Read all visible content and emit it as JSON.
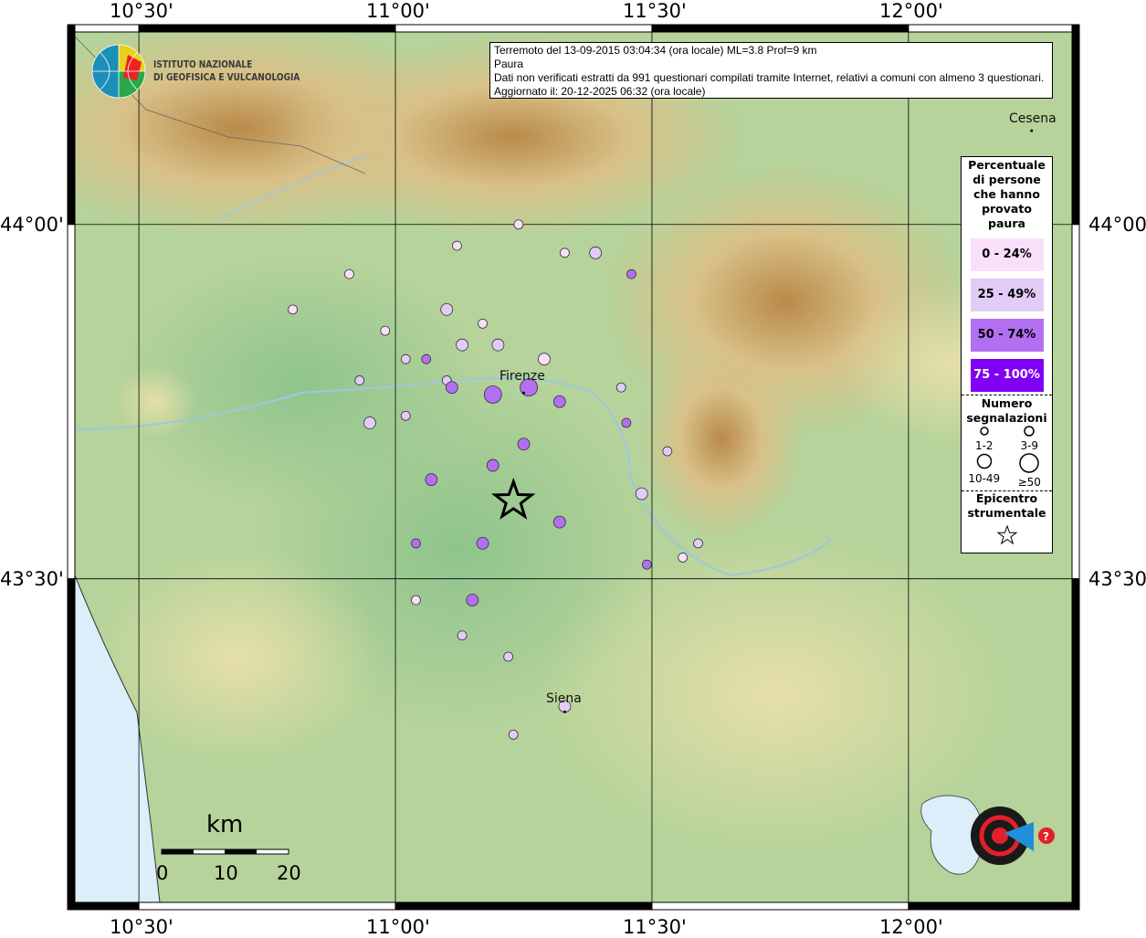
{
  "info_box": {
    "line1": "Terremoto del 13-09-2015 03:04:34 (ora locale) ML=3.8 Prof=9 km",
    "line2": "Paura",
    "line3": "Dati non verificati estratti da 991 questionari compilati tramite Internet, relativi a comuni con almeno 3 questionari.",
    "line4": "Aggiornato il: 20-12-2025 06:32 (ora locale)"
  },
  "axes": {
    "lon_ticks": [
      "10°30'",
      "11°00'",
      "11°30'",
      "12°00'"
    ],
    "lon_values": [
      10.5,
      11.0,
      11.5,
      12.0
    ],
    "lat_ticks": [
      "44°00'",
      "43°30'"
    ],
    "lat_values": [
      44.0,
      43.5
    ],
    "lon_range": [
      10.361,
      12.333
    ],
    "lat_range": [
      43.033,
      44.282
    ]
  },
  "logos": {
    "ingv": "ISTITUTO NAZIONALE DI GEOFISICA E VULCANOLOGIA",
    "ingv_line1": "ISTITUTO NAZIONALE",
    "ingv_line2": "DI GEOFISICA E VULCANOLOGIA",
    "hsit": "www.haisentitoilterremoto.it"
  },
  "cities": [
    {
      "name": "Firenze",
      "lon": 11.25,
      "lat": 43.77
    },
    {
      "name": "Siena",
      "lon": 11.33,
      "lat": 43.32
    },
    {
      "name": "Cesena",
      "lon": 12.24,
      "lat": 44.14
    }
  ],
  "legend": {
    "title": "Percentuale di persone che hanno provato paura",
    "classes": [
      {
        "label": "0 - 24%",
        "color": "#f9dffa"
      },
      {
        "label": "25 - 49%",
        "color": "#e3cbf7"
      },
      {
        "label": "50 - 74%",
        "color": "#b36ff2"
      },
      {
        "label": "75 - 100%",
        "color": "#8000f3"
      }
    ],
    "count_title": "Numero segnalazioni",
    "count_classes": [
      "1-2",
      "3-9",
      "10-49",
      "≥50"
    ],
    "epicenter_title": "Epicentro strumentale"
  },
  "epicenter": {
    "lon": 11.23,
    "lat": 43.61
  },
  "scale_bar": {
    "unit": "km",
    "ticks": [
      "0",
      "10",
      "20"
    ]
  },
  "points": [
    {
      "lon": 11.24,
      "lat": 44.0,
      "c": 0,
      "n": 0
    },
    {
      "lon": 11.12,
      "lat": 43.97,
      "c": 0,
      "n": 0
    },
    {
      "lon": 11.33,
      "lat": 43.96,
      "c": 0,
      "n": 0
    },
    {
      "lon": 11.39,
      "lat": 43.96,
      "c": 1,
      "n": 1
    },
    {
      "lon": 11.46,
      "lat": 43.93,
      "c": 2,
      "n": 0
    },
    {
      "lon": 10.91,
      "lat": 43.93,
      "c": 0,
      "n": 0
    },
    {
      "lon": 10.8,
      "lat": 43.88,
      "c": 0,
      "n": 0
    },
    {
      "lon": 11.1,
      "lat": 43.88,
      "c": 1,
      "n": 1
    },
    {
      "lon": 11.17,
      "lat": 43.86,
      "c": 0,
      "n": 0
    },
    {
      "lon": 10.98,
      "lat": 43.85,
      "c": 0,
      "n": 0
    },
    {
      "lon": 11.2,
      "lat": 43.83,
      "c": 1,
      "n": 1
    },
    {
      "lon": 11.13,
      "lat": 43.83,
      "c": 1,
      "n": 1
    },
    {
      "lon": 11.02,
      "lat": 43.81,
      "c": 1,
      "n": 0
    },
    {
      "lon": 11.06,
      "lat": 43.81,
      "c": 2,
      "n": 0
    },
    {
      "lon": 11.29,
      "lat": 43.81,
      "c": 0,
      "n": 1
    },
    {
      "lon": 10.93,
      "lat": 43.78,
      "c": 1,
      "n": 0
    },
    {
      "lon": 11.1,
      "lat": 43.78,
      "c": 1,
      "n": 0
    },
    {
      "lon": 11.11,
      "lat": 43.77,
      "c": 2,
      "n": 1
    },
    {
      "lon": 11.26,
      "lat": 43.77,
      "c": 2,
      "n": 2
    },
    {
      "lon": 11.19,
      "lat": 43.76,
      "c": 2,
      "n": 2
    },
    {
      "lon": 11.44,
      "lat": 43.77,
      "c": 1,
      "n": 0
    },
    {
      "lon": 11.32,
      "lat": 43.75,
      "c": 2,
      "n": 1
    },
    {
      "lon": 11.02,
      "lat": 43.73,
      "c": 1,
      "n": 0
    },
    {
      "lon": 10.95,
      "lat": 43.72,
      "c": 1,
      "n": 1
    },
    {
      "lon": 11.45,
      "lat": 43.72,
      "c": 2,
      "n": 0
    },
    {
      "lon": 11.25,
      "lat": 43.69,
      "c": 2,
      "n": 1
    },
    {
      "lon": 11.53,
      "lat": 43.68,
      "c": 1,
      "n": 0
    },
    {
      "lon": 11.07,
      "lat": 43.64,
      "c": 2,
      "n": 1
    },
    {
      "lon": 11.19,
      "lat": 43.66,
      "c": 2,
      "n": 1
    },
    {
      "lon": 11.48,
      "lat": 43.62,
      "c": 1,
      "n": 1
    },
    {
      "lon": 11.32,
      "lat": 43.58,
      "c": 2,
      "n": 1
    },
    {
      "lon": 11.04,
      "lat": 43.55,
      "c": 2,
      "n": 0
    },
    {
      "lon": 11.17,
      "lat": 43.55,
      "c": 2,
      "n": 1
    },
    {
      "lon": 11.59,
      "lat": 43.55,
      "c": 1,
      "n": 0
    },
    {
      "lon": 11.56,
      "lat": 43.53,
      "c": 0,
      "n": 0
    },
    {
      "lon": 11.49,
      "lat": 43.52,
      "c": 2,
      "n": 0
    },
    {
      "lon": 11.04,
      "lat": 43.47,
      "c": 0,
      "n": 0
    },
    {
      "lon": 11.15,
      "lat": 43.47,
      "c": 2,
      "n": 1
    },
    {
      "lon": 11.13,
      "lat": 43.42,
      "c": 1,
      "n": 0
    },
    {
      "lon": 11.22,
      "lat": 43.39,
      "c": 1,
      "n": 0
    },
    {
      "lon": 11.33,
      "lat": 43.32,
      "c": 1,
      "n": 1
    },
    {
      "lon": 11.23,
      "lat": 43.28,
      "c": 1,
      "n": 0
    }
  ]
}
